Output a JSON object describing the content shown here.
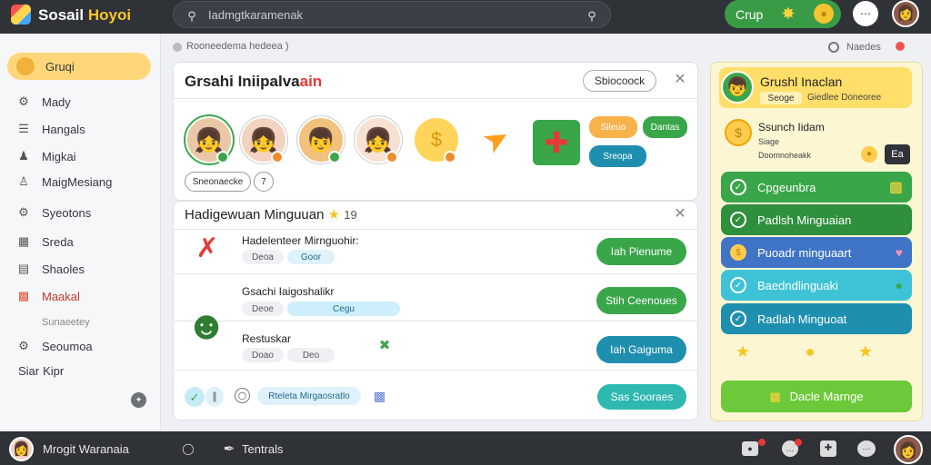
{
  "topbar": {
    "brand_main": "Sosail",
    "brand_accent": "Hoyoi",
    "search_placeholder": "Iadmgtkaramenak",
    "group_label": "Crup"
  },
  "sidebar": {
    "items": [
      {
        "label": "Gruqi",
        "icon": "group-icon"
      },
      {
        "label": "Mady",
        "icon": "settings-icon"
      },
      {
        "label": "Hangals",
        "icon": "sliders-icon"
      },
      {
        "label": "Migkai",
        "icon": "people-icon"
      },
      {
        "label": "MaigMesiang",
        "icon": "person-icon"
      },
      {
        "label": "Syeotons",
        "icon": "gear-icon"
      },
      {
        "label": "Sreda",
        "icon": "grid-icon"
      },
      {
        "label": "Shaoles",
        "icon": "document-icon"
      },
      {
        "label": "Maakal",
        "icon": "gift-icon"
      },
      {
        "label": "Sunaeetey",
        "icon": ""
      },
      {
        "label": "Seoumoa",
        "icon": "settings-icon"
      },
      {
        "label": "Kipr",
        "icon": ""
      }
    ],
    "kipr_prefix": "Siar"
  },
  "breadcrumb": "Rooneedema hedeea )",
  "header_right": "Naedes",
  "members_panel": {
    "title_main": "Grsahi Iniipalva",
    "title_accent": "ain",
    "search_button": "Sbiocoock",
    "chip_more": "Sneonaecke",
    "chip_count": "7",
    "tag_orange": "Sileuo",
    "tag_green": "Dantas",
    "tag_teal": "Sreopa"
  },
  "challenges_panel": {
    "title": "Hadigewuan Minguuan",
    "title_count": "19",
    "rows": [
      {
        "title": "Hadelenteer Mirnguohir:",
        "tag1": "Deoa",
        "tag2": "Goor",
        "button": "Iah Pienume"
      },
      {
        "title": "Gsachi Iaigoshalikr",
        "tag1": "Deoe",
        "tag2": "Cegu",
        "button": "Stih Ceenoues"
      },
      {
        "title": "Restuskar",
        "tag1": "Doao",
        "tag2": "Deo",
        "button": "Iah Gaiguma"
      }
    ],
    "footer_chip": "Rteleta Mirgaosratlo",
    "footer_button": "Sas Sooraes"
  },
  "right_panel": {
    "card_title": "Grushl Inaclan",
    "card_tag": "Seoge",
    "card_sub": "Giedlee Doneoree",
    "search_title": "Ssunch Iidam",
    "search_sub1": "Siage",
    "search_sub2": "Doomnoheakk",
    "search_badge": "Ea",
    "tasks": [
      {
        "label": "Cpgeunbra"
      },
      {
        "label": "Padlsh Minguaian"
      },
      {
        "label": "Puoadr minguaart"
      },
      {
        "label": "Baedndlinguaki"
      },
      {
        "label": "Radlah Minguoat"
      }
    ],
    "cta": "Dacle Marnge"
  },
  "bottombar": {
    "user": "Mrogit Waranaia",
    "compose": "Tentrals"
  },
  "colors": {
    "active_tab": "#ffd77a",
    "green": "#3aa64a",
    "teal": "#1f8fb0",
    "topbar": "#2f3237"
  }
}
